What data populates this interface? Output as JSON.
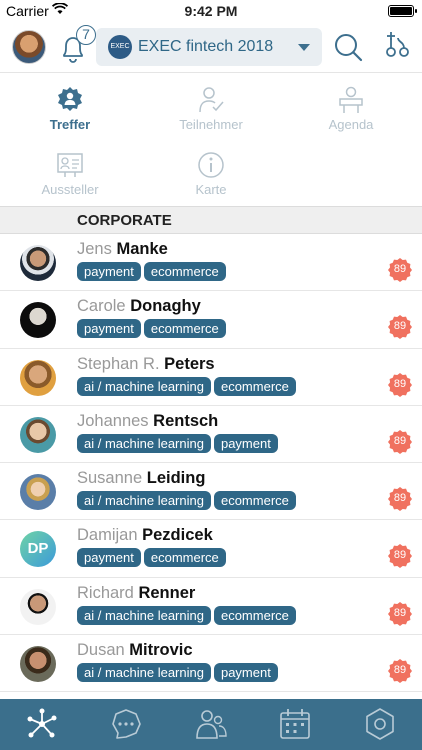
{
  "status_bar": {
    "carrier": "Carrier",
    "time": "9:42 PM"
  },
  "header": {
    "notification_count": "7",
    "event_logo_text": "EXEC",
    "event_name": "EXEC fintech 2018"
  },
  "nav": [
    {
      "label": "Treffer",
      "icon": "match-icon",
      "active": true
    },
    {
      "label": "Teilnehmer",
      "icon": "participant-icon",
      "active": false
    },
    {
      "label": "Agenda",
      "icon": "agenda-icon",
      "active": false
    },
    {
      "label": "Aussteller",
      "icon": "exhibitor-icon",
      "active": false
    },
    {
      "label": "Karte",
      "icon": "info-icon",
      "active": false
    }
  ],
  "section": {
    "title": "CORPORATE"
  },
  "people": [
    {
      "first": "Jens",
      "last": "Manke",
      "tags": [
        "payment",
        "ecommerce"
      ],
      "score": "89"
    },
    {
      "first": "Carole",
      "last": "Donaghy",
      "tags": [
        "payment",
        "ecommerce"
      ],
      "score": "89"
    },
    {
      "first": "Stephan R.",
      "last": "Peters",
      "tags": [
        "ai / machine learning",
        "ecommerce"
      ],
      "score": "89"
    },
    {
      "first": "Johannes",
      "last": "Rentsch",
      "tags": [
        "ai / machine learning",
        "payment"
      ],
      "score": "89"
    },
    {
      "first": "Susanne",
      "last": "Leiding",
      "tags": [
        "ai / machine learning",
        "ecommerce"
      ],
      "score": "89"
    },
    {
      "first": "Damijan",
      "last": "Pezdicek",
      "initials": "DP",
      "tags": [
        "payment",
        "ecommerce"
      ],
      "score": "89"
    },
    {
      "first": "Richard",
      "last": "Renner",
      "tags": [
        "ai / machine learning",
        "ecommerce"
      ],
      "score": "89"
    },
    {
      "first": "Dusan",
      "last": "Mitrovic",
      "tags": [
        "ai / machine learning",
        "payment"
      ],
      "score": "89"
    }
  ],
  "tab_bar": [
    "network-icon",
    "chat-icon",
    "people-icon",
    "calendar-icon",
    "settings-icon"
  ],
  "colors": {
    "accent": "#2f6787",
    "tab_bar": "#3b6f8c",
    "score": "#f0715f",
    "nav_inactive": "#b6c3cc"
  }
}
